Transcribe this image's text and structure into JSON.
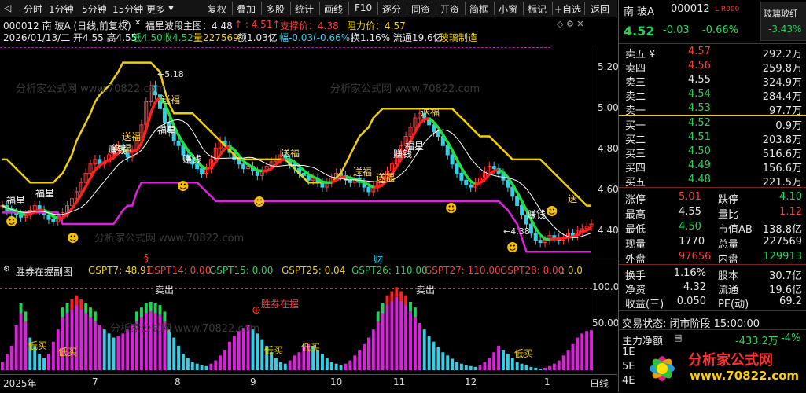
{
  "toolbar": {
    "left_icon": "back-arrow-icon",
    "tabs": [
      "分时",
      "1分钟",
      "5分钟",
      "15分钟",
      "更多"
    ],
    "buttons": [
      "复权",
      "叠加",
      "多股",
      "统计",
      "画线",
      "F10",
      "逐分",
      "同资",
      "开资",
      "简框",
      "小窗",
      "标记",
      "+自选",
      "返回"
    ]
  },
  "main": {
    "title": "000012 南 玻A (日线,前复权)",
    "indicator": "福星波段主图：4.48",
    "value_red": "4.51",
    "support": "支撑价：4.38",
    "resistance": "阻力价：4.57",
    "info_date": "2026/01/13/二 开4.55 高4.55",
    "info_low": "低4.50",
    "info_close": "收4.52",
    "info_vol": "量227569",
    "info_amt": "额1.03亿",
    "info_chg": "幅-0.03(-0.66%)",
    "info_turn": "换1.16% 流通19.6亿",
    "info_industry": "玻璃制造",
    "axis_ticks": [
      "5.20",
      "5.00",
      "4.80",
      "4.60",
      "4.40"
    ],
    "annot_high": "5.18",
    "annot_low": "4.38",
    "chart_labels": [
      "送福",
      "送福",
      "送福",
      "送福",
      "送福",
      "送福",
      "送福",
      "送",
      "赚钱",
      "赚钱",
      "赚钱",
      "赚钱",
      "福星",
      "福星",
      "福星",
      "福星"
    ]
  },
  "sub": {
    "title": "胜券在握副图",
    "items": [
      {
        "text": "GSPT7: 48.91",
        "color": "#f0d000"
      },
      {
        "text": "GSPT14: 0.00",
        "color": "#ff3b3b"
      },
      {
        "text": "GSPT15: 0.00",
        "color": "#22d35a"
      },
      {
        "text": "GSPT25: 0.04",
        "color": "#f0d000"
      },
      {
        "text": "GSPT26: 110.00",
        "color": "#22d35a"
      },
      {
        "text": "GSPT27: 110.00",
        "color": "#ff3b3b"
      },
      {
        "text": "GSPT28: 0.00",
        "color": "#ff3b3b"
      },
      {
        "text": ": 0.0",
        "color": "#f0d000"
      }
    ],
    "axis_ticks": [
      "100.0",
      "50.00"
    ],
    "marker_s": "§",
    "marker_cai": "财",
    "labels": [
      "卖出",
      "卖出",
      "胜券在握",
      "低买",
      "低买",
      "低买",
      "低买",
      "低买"
    ]
  },
  "xaxis": {
    "labels": [
      "2025年",
      "7",
      "8",
      "9",
      "10",
      "11",
      "12",
      "1"
    ],
    "period": "日线"
  },
  "quote": {
    "name": "南 玻A",
    "code": "000012",
    "badge": "L R000",
    "price": "4.52",
    "change": "-0.03",
    "pct": "-0.66%",
    "sector": "玻璃玻纤",
    "sector_pct": "-3.43%",
    "asks": [
      {
        "label": "卖五 ¥",
        "price": "4.57",
        "vol": "292.2万"
      },
      {
        "label": "卖四",
        "price": "4.56",
        "vol": "259.8万"
      },
      {
        "label": "卖三",
        "price": "4.55",
        "vol": "324.9万"
      },
      {
        "label": "卖二",
        "price": "4.54",
        "vol": "284.4万"
      },
      {
        "label": "卖一",
        "price": "4.53",
        "vol": "97.7万"
      }
    ],
    "bids": [
      {
        "label": "买一",
        "price": "4.52",
        "vol": "0.9万"
      },
      {
        "label": "买二",
        "price": "4.51",
        "vol": "203.8万"
      },
      {
        "label": "买三",
        "price": "4.50",
        "vol": "516.6万"
      },
      {
        "label": "买四",
        "price": "4.49",
        "vol": "156.6万"
      },
      {
        "label": "买五",
        "price": "4.48",
        "vol": "221.5万"
      }
    ],
    "stats": [
      {
        "l": "涨停",
        "v": "5.01",
        "vc": "#ff3b3b",
        "l2": "跌停",
        "v2": "4.10",
        "v2c": "#22d35a"
      },
      {
        "l": "最高",
        "v": "4.55",
        "vc": "#e6e6e6",
        "l2": "量比",
        "v2": "1.12",
        "v2c": "#ff3b3b"
      },
      {
        "l": "最低",
        "v": "4.50",
        "vc": "#22d35a",
        "l2": "市值AB",
        "v2": "138.8亿",
        "v2c": "#e6e6e6"
      },
      {
        "l": "现量",
        "v": "1770",
        "vc": "#e6e6e6",
        "l2": "总量",
        "v2": "227569",
        "v2c": "#e6e6e6"
      },
      {
        "l": "外盘",
        "v": "97656",
        "vc": "#ff3b3b",
        "l2": "内盘",
        "v2": "129913",
        "v2c": "#22d35a"
      }
    ],
    "fund": [
      {
        "l": "换手",
        "v": "1.16%",
        "l2": "股本",
        "v2": "30.7亿"
      },
      {
        "l": "净资",
        "v": "4.32",
        "l2": "流通",
        "v2": "19.6亿"
      },
      {
        "l": "收益(三)",
        "v": "0.050",
        "l2": "PE(动)",
        "v2": "69.2"
      }
    ],
    "status": "交易状态: 闭市阶段 15:00:00",
    "netflow_label": "主力净额",
    "netflow": "-433.2万",
    "netflow_pct": "-4%",
    "bottom_rows": [
      "1E",
      "5E",
      "4E"
    ]
  },
  "watermark": {
    "url": "www.70822.com",
    "brand": "分析家公式网",
    "text": "分析家公式网 www.70822.com"
  },
  "colors": {
    "up": "#ff3b3b",
    "down": "#22d35a",
    "yellow": "#f0d000",
    "magenta": "#e020e0",
    "cyan": "#33cfe8"
  },
  "chart_data": {
    "type": "candlestick",
    "ylim": [
      4.36,
      5.28
    ],
    "closes": [
      4.6,
      4.58,
      4.57,
      4.56,
      4.55,
      4.56,
      4.58,
      4.6,
      4.58,
      4.56,
      4.54,
      4.53,
      4.55,
      4.57,
      4.6,
      4.63,
      4.66,
      4.7,
      4.74,
      4.78,
      4.8,
      4.78,
      4.79,
      4.82,
      4.84,
      4.86,
      4.83,
      4.81,
      4.84,
      4.88,
      4.95,
      5.05,
      5.12,
      5.08,
      5.02,
      4.96,
      4.92,
      4.88,
      4.86,
      4.82,
      4.8,
      4.78,
      4.76,
      4.74,
      4.76,
      4.8,
      4.85,
      4.88,
      4.86,
      4.83,
      4.8,
      4.78,
      4.76,
      4.77,
      4.75,
      4.73,
      4.75,
      4.77,
      4.79,
      4.8,
      4.82,
      4.8,
      4.78,
      4.76,
      4.74,
      4.73,
      4.71,
      4.72,
      4.7,
      4.68,
      4.7,
      4.72,
      4.74,
      4.73,
      4.71,
      4.7,
      4.72,
      4.7,
      4.68,
      4.66,
      4.68,
      4.7,
      4.72,
      4.75,
      4.78,
      4.82,
      4.86,
      4.9,
      4.94,
      4.98,
      5.0,
      4.98,
      4.95,
      4.92,
      4.9,
      4.86,
      4.82,
      4.78,
      4.74,
      4.71,
      4.69,
      4.68,
      4.7,
      4.72,
      4.75,
      4.77,
      4.76,
      4.74,
      4.71,
      4.68,
      4.64,
      4.6,
      4.56,
      4.52,
      4.48,
      4.45,
      4.44,
      4.45,
      4.47,
      4.46,
      4.45,
      4.46,
      4.48,
      4.47,
      4.49,
      4.5,
      4.51,
      4.52
    ],
    "upper_band": [
      4.8,
      4.8,
      4.78,
      4.76,
      4.74,
      4.72,
      4.7,
      4.7,
      4.7,
      4.7,
      4.7,
      4.7,
      4.72,
      4.74,
      4.78,
      4.82,
      4.88,
      4.92,
      4.96,
      5.0,
      5.05,
      5.08,
      5.1,
      5.12,
      5.15,
      5.18,
      5.22,
      5.22,
      5.22,
      5.22,
      5.22,
      5.22,
      5.22,
      5.2,
      5.18,
      5.1,
      5.04,
      5.0,
      5.0,
      5.0,
      5.0,
      5.0,
      4.98,
      4.96,
      4.94,
      4.92,
      4.9,
      4.88,
      4.86,
      4.84,
      4.82,
      4.8,
      4.8,
      4.8,
      4.8,
      4.8,
      4.8,
      4.8,
      4.8,
      4.8,
      4.8,
      4.8,
      4.78,
      4.76,
      4.74,
      4.72,
      4.7,
      4.7,
      4.7,
      4.7,
      4.7,
      4.7,
      4.72,
      4.74,
      4.78,
      4.82,
      4.86,
      4.9,
      4.92,
      4.94,
      4.98,
      5.0,
      5.02,
      5.02,
      5.02,
      5.02,
      5.02,
      5.02,
      5.02,
      5.02,
      5.02,
      5.02,
      5.02,
      5.02,
      5.02,
      5.02,
      5.02,
      5.02,
      5.0,
      4.98,
      4.96,
      4.94,
      4.92,
      4.9,
      4.9,
      4.9,
      4.88,
      4.86,
      4.84,
      4.82,
      4.8,
      4.8,
      4.8,
      4.8,
      4.8,
      4.8,
      4.8,
      4.78,
      4.76,
      4.74,
      4.72,
      4.7,
      4.68,
      4.66,
      4.64,
      4.62,
      4.6,
      4.6
    ],
    "lower_band": [
      4.57,
      4.57,
      4.57,
      4.57,
      4.57,
      4.57,
      4.57,
      4.57,
      4.57,
      4.57,
      4.57,
      4.57,
      4.57,
      4.52,
      4.52,
      4.52,
      4.52,
      4.52,
      4.52,
      4.52,
      4.52,
      4.52,
      4.52,
      4.52,
      4.52,
      4.55,
      4.58,
      4.6,
      4.6,
      4.66,
      4.7,
      4.7,
      4.7,
      4.7,
      4.7,
      4.7,
      4.7,
      4.7,
      4.7,
      4.7,
      4.7,
      4.7,
      4.7,
      4.68,
      4.66,
      4.64,
      4.62,
      4.62,
      4.62,
      4.62,
      4.62,
      4.62,
      4.62,
      4.62,
      4.62,
      4.62,
      4.62,
      4.62,
      4.62,
      4.62,
      4.62,
      4.62,
      4.62,
      4.62,
      4.62,
      4.62,
      4.62,
      4.62,
      4.62,
      4.62,
      4.62,
      4.62,
      4.62,
      4.62,
      4.62,
      4.62,
      4.62,
      4.62,
      4.62,
      4.62,
      4.62,
      4.62,
      4.62,
      4.62,
      4.62,
      4.62,
      4.62,
      4.62,
      4.62,
      4.62,
      4.62,
      4.62,
      4.62,
      4.62,
      4.62,
      4.62,
      4.62,
      4.62,
      4.62,
      4.62,
      4.62,
      4.62,
      4.62,
      4.62,
      4.62,
      4.62,
      4.62,
      4.62,
      4.6,
      4.58,
      4.55,
      4.52,
      4.46,
      4.4,
      4.4,
      4.4,
      4.4,
      4.4,
      4.4,
      4.4,
      4.4,
      4.4,
      4.4,
      4.4,
      4.4,
      4.4,
      4.4,
      4.4
    ],
    "sub_values": [
      10,
      20,
      30,
      55,
      70,
      60,
      40,
      30,
      20,
      15,
      20,
      35,
      50,
      65,
      70,
      75,
      80,
      75,
      70,
      65,
      60,
      55,
      50,
      45,
      40,
      42,
      45,
      50,
      55,
      60,
      65,
      70,
      72,
      70,
      68,
      60,
      50,
      40,
      30,
      20,
      15,
      10,
      8,
      6,
      5,
      8,
      12,
      18,
      25,
      35,
      42,
      48,
      52,
      55,
      50,
      45,
      38,
      30,
      22,
      15,
      10,
      8,
      12,
      18,
      22,
      28,
      32,
      30,
      25,
      20,
      15,
      10,
      8,
      6,
      8,
      12,
      18,
      25,
      32,
      40,
      50,
      60,
      70,
      80,
      85,
      90,
      85,
      80,
      72,
      65,
      58,
      50,
      42,
      35,
      28,
      22,
      18,
      14,
      10,
      8,
      6,
      5,
      4,
      6,
      10,
      15,
      22,
      30,
      25,
      20,
      15,
      10,
      8,
      6,
      4,
      3,
      2,
      3,
      5,
      8,
      12,
      18,
      25,
      32,
      40,
      45,
      48,
      49
    ]
  }
}
